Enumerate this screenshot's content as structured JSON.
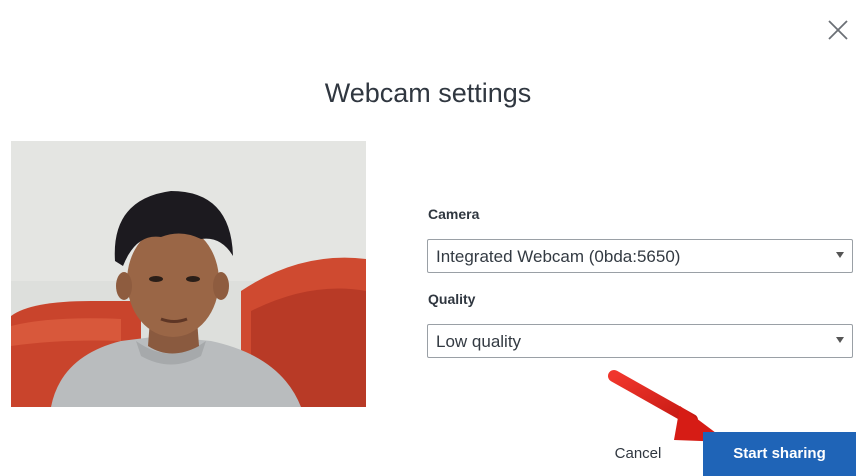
{
  "dialog": {
    "title": "Webcam settings",
    "close_icon": "close-icon"
  },
  "preview": {
    "image": "webcam-preview"
  },
  "camera": {
    "label": "Camera",
    "selected": "Integrated Webcam (0bda:5650)"
  },
  "quality": {
    "label": "Quality",
    "selected": "Low quality"
  },
  "actions": {
    "cancel": "Cancel",
    "start": "Start sharing"
  },
  "colors": {
    "primary": "#1f64b7",
    "annotation_arrow": "#e0211b"
  }
}
